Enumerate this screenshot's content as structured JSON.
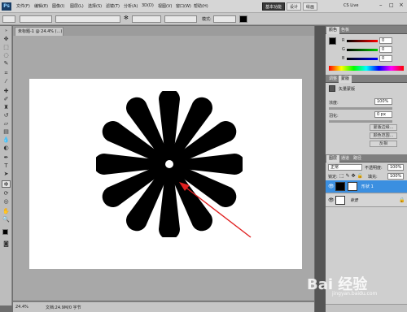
{
  "app": {
    "logo": "Ps",
    "zoom": "24.4",
    "workspace_buttons": [
      "基本功能",
      "设计",
      "绘画"
    ],
    "cs_live": "CS Live"
  },
  "menu": [
    "文件(F)",
    "编辑(E)",
    "图像(I)",
    "图层(L)",
    "选择(S)",
    "滤镜(T)",
    "分析(A)",
    "3D(D)",
    "视图(V)",
    "窗口(W)",
    "帮助(H)"
  ],
  "options": {
    "mode_label": "模式:",
    "mode_value": "正常",
    "opacity_label": "不透明度",
    "opacity_value": "100%"
  },
  "document": {
    "tab_label": "未标题-1 @ 24.4% (...)"
  },
  "status": {
    "zoom": "24.4%",
    "doc_info": "文档:24.9M/0 字节"
  },
  "color_panel": {
    "tabs": [
      "颜色",
      "色板"
    ],
    "channels": [
      "R",
      "G",
      "B"
    ],
    "values": [
      "0",
      "0",
      "0"
    ]
  },
  "adjust_panel": {
    "tabs": [
      "调整",
      "蒙版"
    ],
    "title": "矢量蒙版",
    "density_label": "浓度:",
    "density_value": "100%",
    "feather_label": "羽化:",
    "feather_value": "0 px",
    "buttons": [
      "蒙版边缘...",
      "颜色范围...",
      "反相"
    ]
  },
  "layers_panel": {
    "tabs": [
      "图层",
      "通道",
      "路径"
    ],
    "blend_mode": "正常",
    "opacity_label": "不透明度:",
    "opacity_value": "100%",
    "lock_label": "锁定:",
    "fill_label": "填充:",
    "fill_value": "100%",
    "layers": [
      {
        "name": "形状 1",
        "selected": true
      },
      {
        "name": "背景",
        "selected": false
      }
    ]
  },
  "watermark": {
    "main": "Bai 经验",
    "sub": "jingyan.baidu.com"
  },
  "colors": {
    "accent": "#3b8fe0",
    "arrow": "#e02020",
    "shape": "#000000"
  },
  "icons": [
    "move-icon",
    "marquee-icon",
    "lasso-icon",
    "quick-select-icon",
    "crop-icon",
    "eyedropper-icon",
    "healing-icon",
    "brush-icon",
    "stamp-icon",
    "history-brush-icon",
    "eraser-icon",
    "gradient-icon",
    "blur-icon",
    "dodge-icon",
    "pen-icon",
    "type-icon",
    "path-select-icon",
    "shape-icon",
    "3d-rotate-icon",
    "3d-orbit-icon",
    "hand-icon",
    "zoom-icon"
  ]
}
